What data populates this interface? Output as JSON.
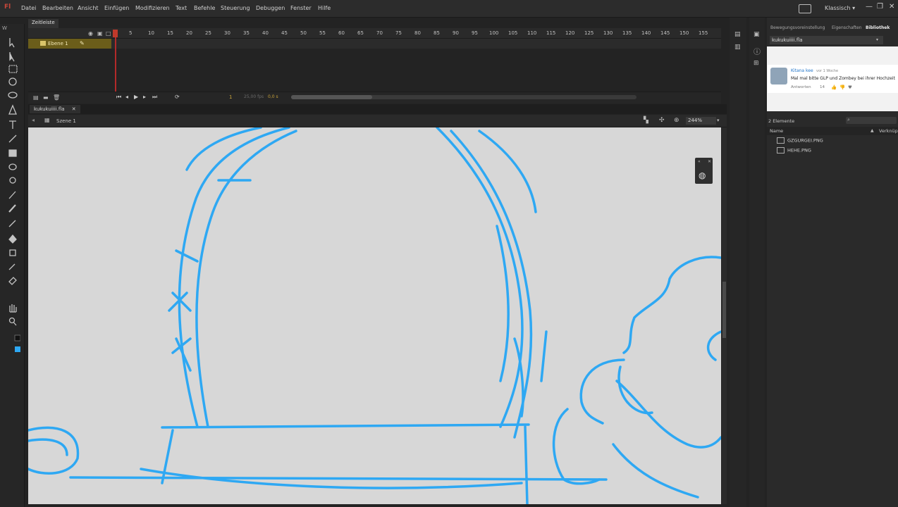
{
  "app": {
    "logo": "Fl"
  },
  "menu": [
    "Datei",
    "Bearbeiten",
    "Ansicht",
    "Einfügen",
    "Modifizieren",
    "Text",
    "Befehle",
    "Steuerung",
    "Debuggen",
    "Fenster",
    "Hilfe"
  ],
  "workspace": {
    "label": "Klassisch",
    "arrow": "▾"
  },
  "window_controls": {
    "minimize": "—",
    "restore": "❐",
    "close": "✕"
  },
  "timeline": {
    "tab": "Zeitleiste",
    "frame_numbers": [
      "1",
      "5",
      "10",
      "15",
      "20",
      "25",
      "30",
      "35",
      "40",
      "45",
      "50",
      "55",
      "60",
      "65",
      "70",
      "75",
      "80",
      "85",
      "90",
      "95",
      "100",
      "105",
      "110",
      "115",
      "120",
      "125",
      "130",
      "135",
      "140",
      "145",
      "150",
      "155"
    ],
    "layer": {
      "name": "Ebene 1"
    },
    "current_frame": "1",
    "fps": "25,00 fps",
    "time": "0,0 s"
  },
  "document": {
    "tab": "kukukuiiii.fla",
    "scene": "Szene 1",
    "zoom": "244%"
  },
  "right_panel": {
    "tabs": [
      "Bewegungsvoreinstellung",
      "Eigenschaften",
      "Bibliothek"
    ],
    "library_file": "kukukuiiii.fla",
    "comment": {
      "user": "Kitana kee",
      "time": "vor 1 Woche",
      "text": "Mal mal bitte GLP und Zombey bei ihrer Hochzeit",
      "reply": "Antworten",
      "likes": "14"
    },
    "count": "2 Elemente",
    "columns": {
      "name": "Name",
      "link": "Verknüpf"
    },
    "items": [
      "GZGURGEI.PNG",
      "HEHE.PNG"
    ]
  },
  "colors": {
    "stroke": "#2ea8f3",
    "stage": "#d7d7d7",
    "layer_highlight": "#6b5d1a",
    "playhead": "#b32a2a"
  },
  "icons": [
    "selection-tool-icon",
    "subselection-tool-icon",
    "free-transform-tool-icon",
    "3d-rotation-tool-icon",
    "lasso-tool-icon",
    "pen-tool-icon",
    "text-tool-icon",
    "line-tool-icon",
    "rectangle-tool-icon",
    "oval-tool-icon",
    "pencil-tool-icon",
    "brush-tool-icon",
    "bone-tool-icon",
    "paint-bucket-tool-icon",
    "eyedropper-tool-icon",
    "eraser-tool-icon",
    "hand-tool-icon",
    "zoom-tool-icon"
  ]
}
